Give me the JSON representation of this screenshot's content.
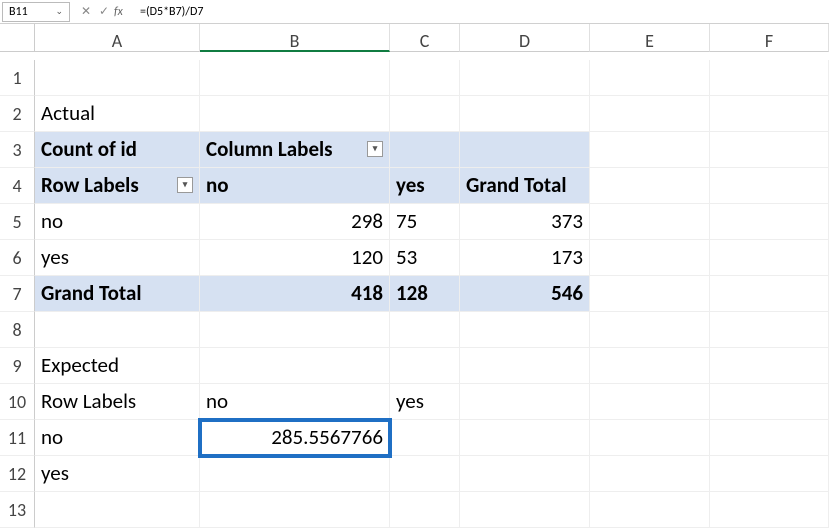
{
  "formula_bar": {
    "cell_ref": "B11",
    "fx_label": "fx",
    "formula": "=(D5*B7)/D7"
  },
  "columns": [
    "A",
    "B",
    "C",
    "D",
    "E",
    "F"
  ],
  "row_numbers": [
    "1",
    "2",
    "3",
    "4",
    "5",
    "6",
    "7",
    "8",
    "9",
    "10",
    "11",
    "12",
    "13"
  ],
  "cells": {
    "A2": "Actual",
    "A3": "Count of id",
    "B3": "Column Labels",
    "A4": "Row Labels",
    "B4": "no",
    "C4": "yes",
    "D4": "Grand Total",
    "A5": "no",
    "B5": "298",
    "C5": "75",
    "D5": "373",
    "A6": "yes",
    "B6": "120",
    "C6": "53",
    "D6": "173",
    "A7": "Grand Total",
    "B7": "418",
    "C7": "128",
    "D7": "546",
    "A9": "Expected",
    "A10": "Row Labels",
    "B10": "no",
    "C10": "yes",
    "A11": "no",
    "B11": "285.5567766",
    "A12": "yes"
  },
  "icons": {
    "cancel": "✕",
    "confirm": "✓",
    "dropdown": "▾",
    "chevron": "⌄"
  }
}
